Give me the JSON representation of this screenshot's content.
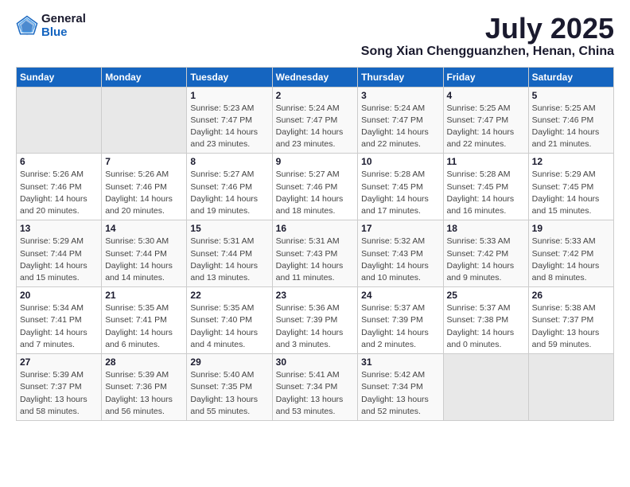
{
  "logo": {
    "general": "General",
    "blue": "Blue"
  },
  "header": {
    "month": "July 2025",
    "location": "Song Xian Chengguanzhen, Henan, China"
  },
  "days": [
    "Sunday",
    "Monday",
    "Tuesday",
    "Wednesday",
    "Thursday",
    "Friday",
    "Saturday"
  ],
  "weeks": [
    [
      {
        "day": "",
        "empty": true
      },
      {
        "day": "",
        "empty": true
      },
      {
        "day": "1",
        "sunrise": "5:23 AM",
        "sunset": "7:47 PM",
        "daylight": "14 hours and 23 minutes."
      },
      {
        "day": "2",
        "sunrise": "5:24 AM",
        "sunset": "7:47 PM",
        "daylight": "14 hours and 23 minutes."
      },
      {
        "day": "3",
        "sunrise": "5:24 AM",
        "sunset": "7:47 PM",
        "daylight": "14 hours and 22 minutes."
      },
      {
        "day": "4",
        "sunrise": "5:25 AM",
        "sunset": "7:47 PM",
        "daylight": "14 hours and 22 minutes."
      },
      {
        "day": "5",
        "sunrise": "5:25 AM",
        "sunset": "7:46 PM",
        "daylight": "14 hours and 21 minutes."
      }
    ],
    [
      {
        "day": "6",
        "sunrise": "5:26 AM",
        "sunset": "7:46 PM",
        "daylight": "14 hours and 20 minutes."
      },
      {
        "day": "7",
        "sunrise": "5:26 AM",
        "sunset": "7:46 PM",
        "daylight": "14 hours and 20 minutes."
      },
      {
        "day": "8",
        "sunrise": "5:27 AM",
        "sunset": "7:46 PM",
        "daylight": "14 hours and 19 minutes."
      },
      {
        "day": "9",
        "sunrise": "5:27 AM",
        "sunset": "7:46 PM",
        "daylight": "14 hours and 18 minutes."
      },
      {
        "day": "10",
        "sunrise": "5:28 AM",
        "sunset": "7:45 PM",
        "daylight": "14 hours and 17 minutes."
      },
      {
        "day": "11",
        "sunrise": "5:28 AM",
        "sunset": "7:45 PM",
        "daylight": "14 hours and 16 minutes."
      },
      {
        "day": "12",
        "sunrise": "5:29 AM",
        "sunset": "7:45 PM",
        "daylight": "14 hours and 15 minutes."
      }
    ],
    [
      {
        "day": "13",
        "sunrise": "5:29 AM",
        "sunset": "7:44 PM",
        "daylight": "14 hours and 15 minutes."
      },
      {
        "day": "14",
        "sunrise": "5:30 AM",
        "sunset": "7:44 PM",
        "daylight": "14 hours and 14 minutes."
      },
      {
        "day": "15",
        "sunrise": "5:31 AM",
        "sunset": "7:44 PM",
        "daylight": "14 hours and 13 minutes."
      },
      {
        "day": "16",
        "sunrise": "5:31 AM",
        "sunset": "7:43 PM",
        "daylight": "14 hours and 11 minutes."
      },
      {
        "day": "17",
        "sunrise": "5:32 AM",
        "sunset": "7:43 PM",
        "daylight": "14 hours and 10 minutes."
      },
      {
        "day": "18",
        "sunrise": "5:33 AM",
        "sunset": "7:42 PM",
        "daylight": "14 hours and 9 minutes."
      },
      {
        "day": "19",
        "sunrise": "5:33 AM",
        "sunset": "7:42 PM",
        "daylight": "14 hours and 8 minutes."
      }
    ],
    [
      {
        "day": "20",
        "sunrise": "5:34 AM",
        "sunset": "7:41 PM",
        "daylight": "14 hours and 7 minutes."
      },
      {
        "day": "21",
        "sunrise": "5:35 AM",
        "sunset": "7:41 PM",
        "daylight": "14 hours and 6 minutes."
      },
      {
        "day": "22",
        "sunrise": "5:35 AM",
        "sunset": "7:40 PM",
        "daylight": "14 hours and 4 minutes."
      },
      {
        "day": "23",
        "sunrise": "5:36 AM",
        "sunset": "7:39 PM",
        "daylight": "14 hours and 3 minutes."
      },
      {
        "day": "24",
        "sunrise": "5:37 AM",
        "sunset": "7:39 PM",
        "daylight": "14 hours and 2 minutes."
      },
      {
        "day": "25",
        "sunrise": "5:37 AM",
        "sunset": "7:38 PM",
        "daylight": "14 hours and 0 minutes."
      },
      {
        "day": "26",
        "sunrise": "5:38 AM",
        "sunset": "7:37 PM",
        "daylight": "13 hours and 59 minutes."
      }
    ],
    [
      {
        "day": "27",
        "sunrise": "5:39 AM",
        "sunset": "7:37 PM",
        "daylight": "13 hours and 58 minutes."
      },
      {
        "day": "28",
        "sunrise": "5:39 AM",
        "sunset": "7:36 PM",
        "daylight": "13 hours and 56 minutes."
      },
      {
        "day": "29",
        "sunrise": "5:40 AM",
        "sunset": "7:35 PM",
        "daylight": "13 hours and 55 minutes."
      },
      {
        "day": "30",
        "sunrise": "5:41 AM",
        "sunset": "7:34 PM",
        "daylight": "13 hours and 53 minutes."
      },
      {
        "day": "31",
        "sunrise": "5:42 AM",
        "sunset": "7:34 PM",
        "daylight": "13 hours and 52 minutes."
      },
      {
        "day": "",
        "empty": true
      },
      {
        "day": "",
        "empty": true
      }
    ]
  ]
}
